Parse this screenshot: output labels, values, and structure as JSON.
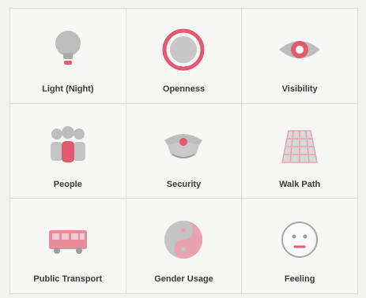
{
  "colors": {
    "accent": "#e25a6f",
    "gray": "#bdbdbd",
    "dark_gray": "#8f8f8f"
  },
  "tiles": [
    {
      "label": "Light (Night)",
      "icon": "light-bulb-icon"
    },
    {
      "label": "Openness",
      "icon": "openness-circle-icon"
    },
    {
      "label": "Visibility",
      "icon": "eye-icon"
    },
    {
      "label": "People",
      "icon": "people-group-icon"
    },
    {
      "label": "Security",
      "icon": "police-cap-icon"
    },
    {
      "label": "Walk Path",
      "icon": "walk-path-icon"
    },
    {
      "label": "Public Transport",
      "icon": "bus-icon"
    },
    {
      "label": "Gender Usage",
      "icon": "yin-yang-icon"
    },
    {
      "label": "Feeling",
      "icon": "face-icon"
    }
  ]
}
